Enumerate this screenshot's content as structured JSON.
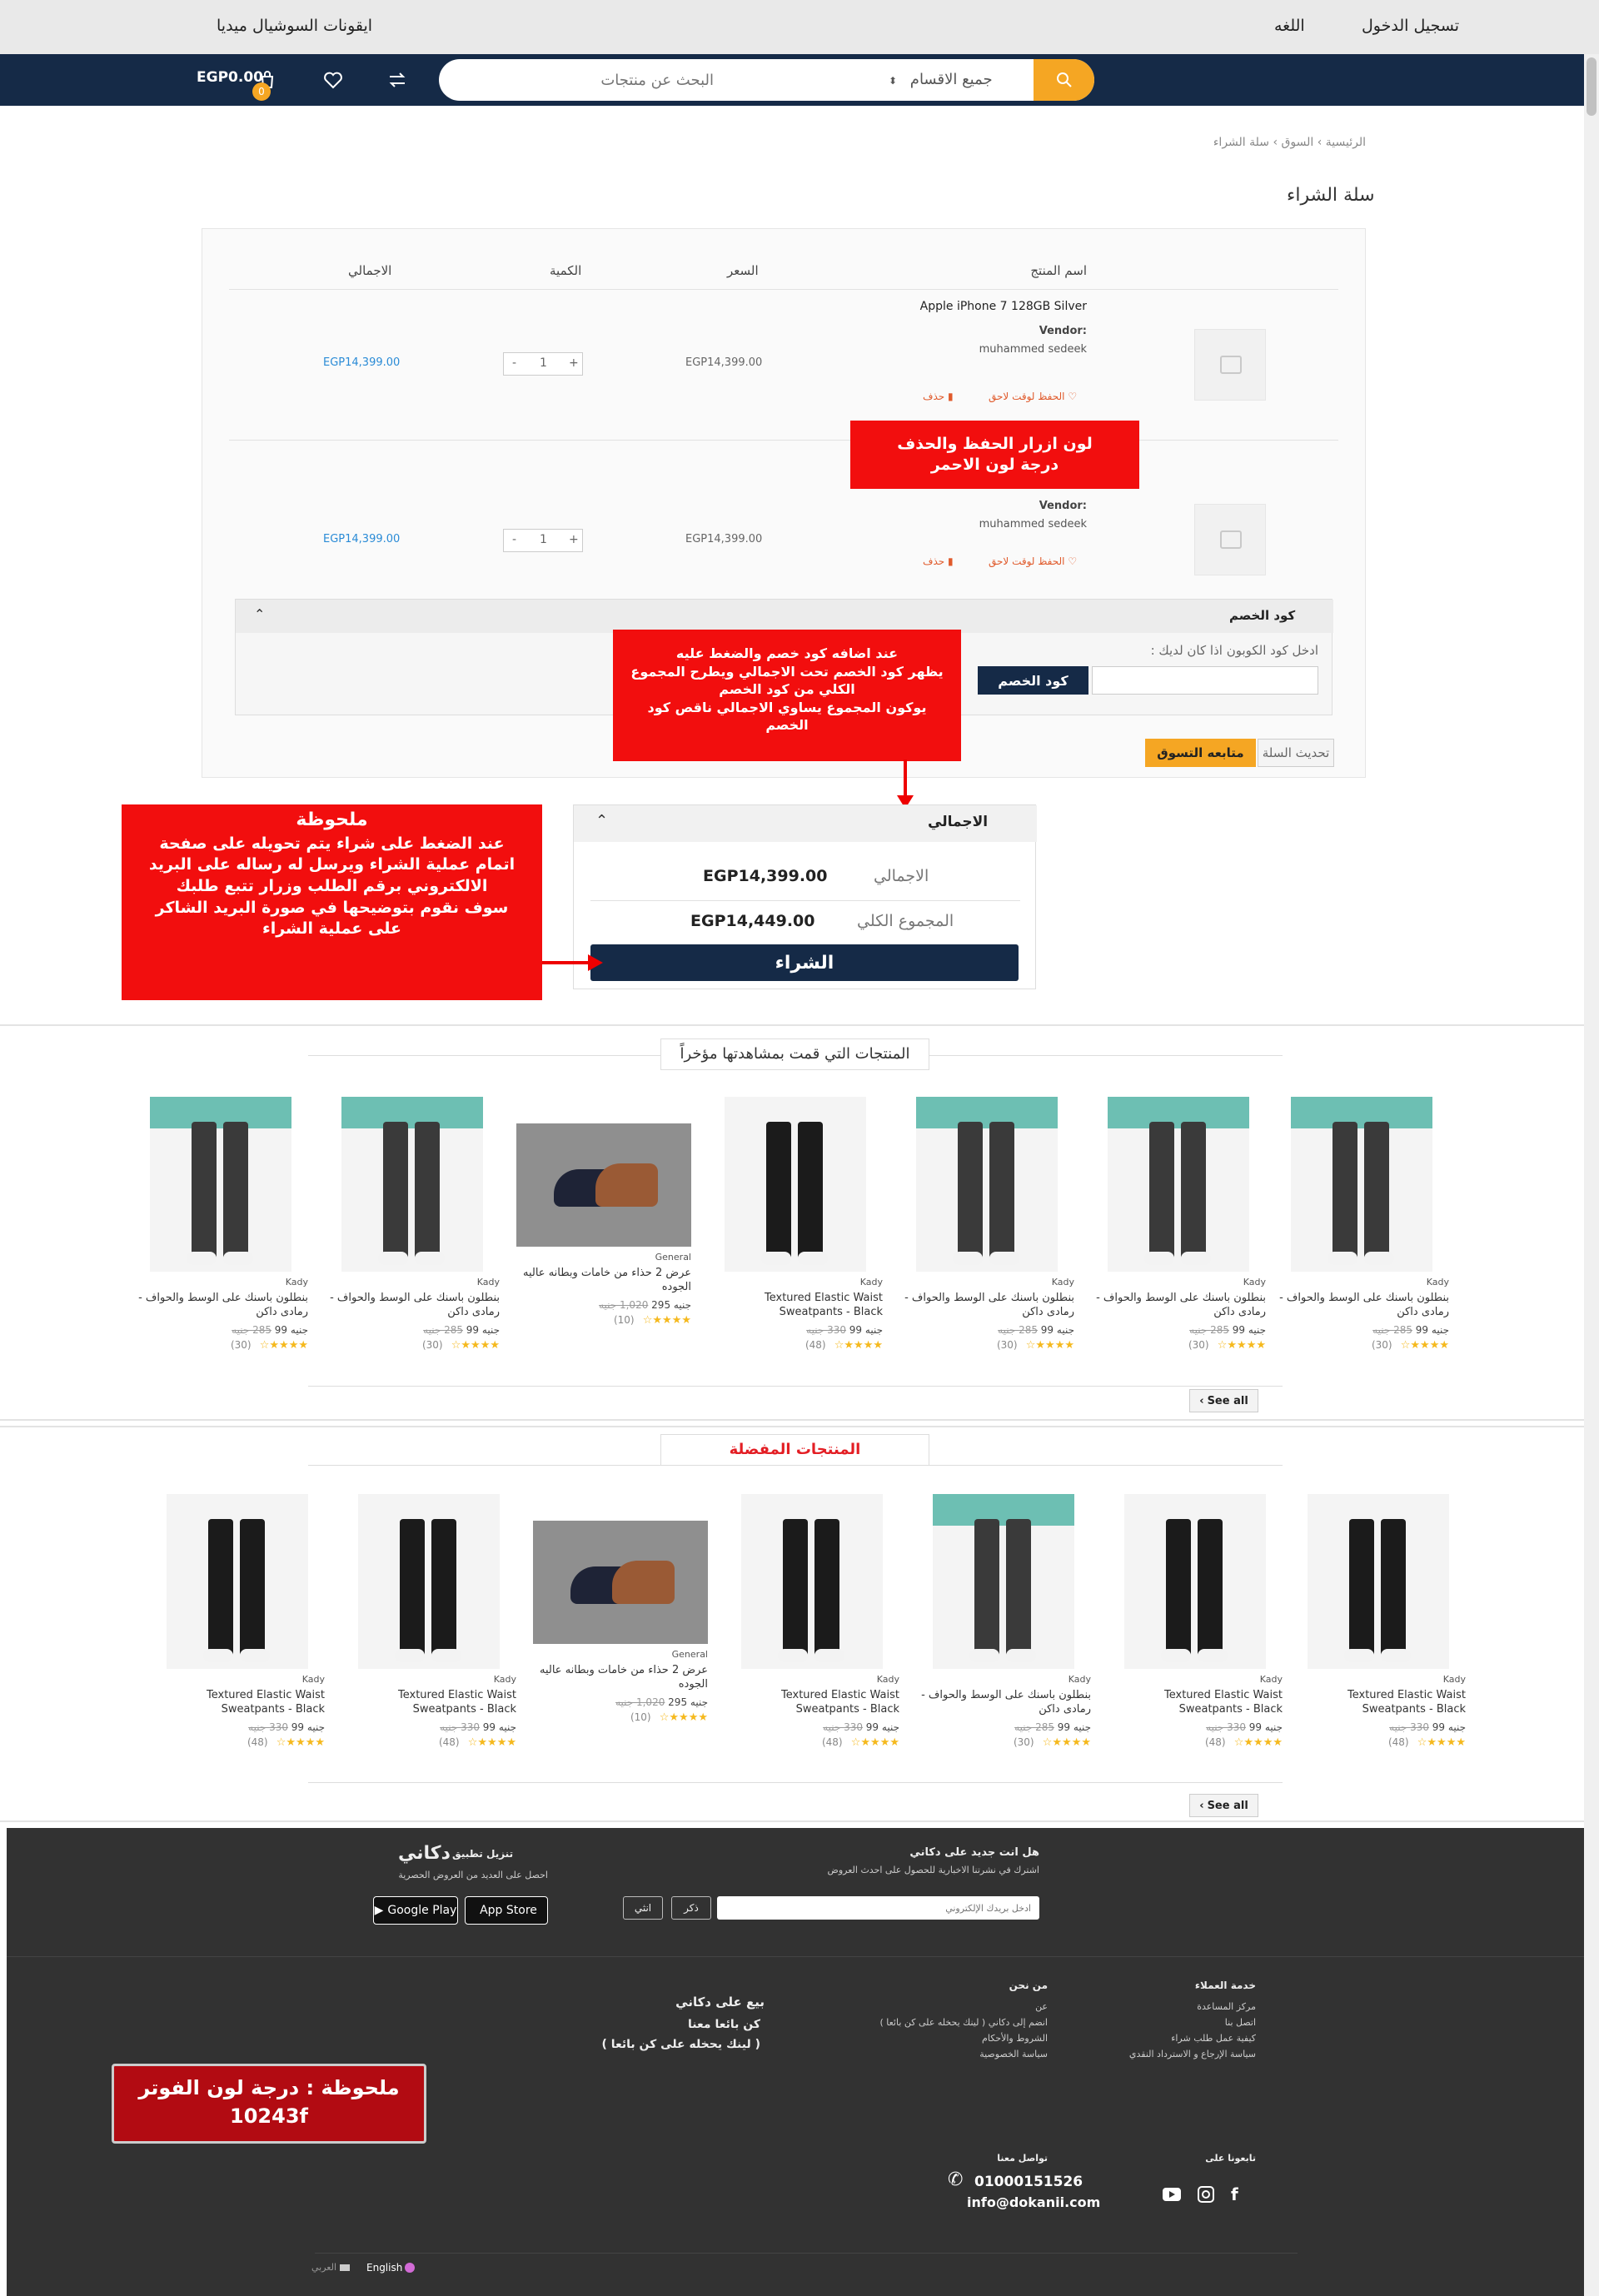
{
  "topbar": {
    "login": "تسجيل الدخول",
    "language": "اللغه",
    "social": "ايقونات السوشيال ميديا"
  },
  "navbar": {
    "search_placeholder": "البحث عن منتجات",
    "category": "جميع الاقسام",
    "cart_count": "0",
    "cart_total": "EGP0.00"
  },
  "breadcrumb": {
    "home": "الرئيسية",
    "market": "السوق",
    "current": "سلة الشراء"
  },
  "page_title": "سلة الشراء",
  "cart": {
    "headers": {
      "product": "اسم المنتج",
      "price": "السعر",
      "qty": "الكمية",
      "total": "الاجمالي"
    },
    "items": [
      {
        "name": "Apple iPhone 7 128GB Silver",
        "vendor_label": "Vendor:",
        "vendor": "muhammed sedeek",
        "price": "EGP14,399.00",
        "qty": "1",
        "total": "EGP14,399.00",
        "save": "الحفظ لوقت لاحق",
        "delete": "حذف"
      },
      {
        "name": "",
        "vendor_label": "Vendor:",
        "vendor": "muhammed sedeek",
        "price": "EGP14,399.00",
        "qty": "1",
        "total": "EGP14,399.00",
        "save": "الحفظ لوقت لاحق",
        "delete": "حذف"
      }
    ],
    "coupon": {
      "title": "كود الخصم",
      "prompt": "ادخل كود الكوبون اذا كان لديك :",
      "button": "كود الخصم"
    },
    "update_cart": "تحديث السلة",
    "continue_shopping": "متابعه التسوق"
  },
  "annotations": {
    "buttons_color": "لون ازرار الحفظ والحذف\nدرجة لون الاحمر",
    "coupon_note": "عند اضافه كود خصم والضغط عليه\nيظهر كود الخصم تحت الاجمالي ويطرح المجموع\nالكلي من كود الخصم\nيوكون المجموع يساوي الاجمالي ناقص كود\nالخصم",
    "note_title": "ملحوظة",
    "note_body": "عند الضغط على شراء يتم تحويله على صفحة\nاتمام عملية الشراء ويرسل له رساله على البريد\nالالكتروني برقم الطلب وزرار تتبع طلبك\nسوف نقوم بتوضيحها في صورة البريد الشاكر\nعلى عملية الشراء",
    "footer_note": "ملحوظة : درجة لون الفوتر\n10243f"
  },
  "totals": {
    "title": "الاجمالي",
    "subtotal_label": "الاجمالي",
    "subtotal": "EGP14,399.00",
    "grand_label": "المجموع الكلي",
    "grand": "EGP14,449.00",
    "buy": "الشراء"
  },
  "recent": {
    "title": "المنتجات التي قمت بمشاهدتها مؤخراً",
    "see_all": "See all",
    "products": [
      {
        "brand": "Kady",
        "name": "بنطلون باسنك على الوسط والحواف - رمادى داكن",
        "price": "جنيه 99",
        "old": "285 جنيه",
        "reviews": "(30)",
        "type": "jogger"
      },
      {
        "brand": "Kady",
        "name": "بنطلون باسنك على الوسط والحواف - رمادى داكن",
        "price": "جنيه 99",
        "old": "285 جنيه",
        "reviews": "(30)",
        "type": "jogger"
      },
      {
        "brand": "Kady",
        "name": "بنطلون باسنك على الوسط والحواف - رمادى داكن",
        "price": "جنيه 99",
        "old": "285 جنيه",
        "reviews": "(30)",
        "type": "jogger"
      },
      {
        "brand": "Kady",
        "name": "Textured Elastic Waist Sweatpants - Black",
        "price": "جنيه 99",
        "old": "330 جنيه",
        "reviews": "(48)",
        "type": "sweat"
      },
      {
        "brand": "General",
        "name": "عرض 2 حذاء من خامات وبطانه عاليه الجوده",
        "price": "جنيه 295",
        "old": "1,020 جنيه",
        "reviews": "(10)",
        "type": "shoes"
      },
      {
        "brand": "Kady",
        "name": "بنطلون باسنك على الوسط والحواف - رمادى داكن",
        "price": "جنيه 99",
        "old": "285 جنيه",
        "reviews": "(30)",
        "type": "jogger"
      },
      {
        "brand": "Kady",
        "name": "بنطلون باسنك على الوسط والحواف - رمادى داكن",
        "price": "جنيه 99",
        "old": "285 جنيه",
        "reviews": "(30)",
        "type": "jogger"
      }
    ]
  },
  "favorites": {
    "title": "المنتجات المفضلة",
    "see_all": "See all",
    "products": [
      {
        "brand": "Kady",
        "name": "Textured Elastic Waist Sweatpants - Black",
        "price": "جنيه 99",
        "old": "330 جنيه",
        "reviews": "(48)",
        "type": "sweat"
      },
      {
        "brand": "Kady",
        "name": "Textured Elastic Waist Sweatpants - Black",
        "price": "جنيه 99",
        "old": "330 جنيه",
        "reviews": "(48)",
        "type": "sweat"
      },
      {
        "brand": "Kady",
        "name": "بنطلون باسنك على الوسط والحواف - رمادى داكن",
        "price": "جنيه 99",
        "old": "285 جنيه",
        "reviews": "(30)",
        "type": "jogger"
      },
      {
        "brand": "Kady",
        "name": "Textured Elastic Waist Sweatpants - Black",
        "price": "جنيه 99",
        "old": "330 جنيه",
        "reviews": "(48)",
        "type": "sweat"
      },
      {
        "brand": "General",
        "name": "عرض 2 حذاء من خامات وبطانه عاليه الجوده",
        "price": "جنيه 295",
        "old": "1,020 جنيه",
        "reviews": "(10)",
        "type": "shoes"
      },
      {
        "brand": "Kady",
        "name": "Textured Elastic Waist Sweatpants - Black",
        "price": "جنيه 99",
        "old": "330 جنيه",
        "reviews": "(48)",
        "type": "sweat"
      },
      {
        "brand": "Kady",
        "name": "Textured Elastic Waist Sweatpants - Black",
        "price": "جنيه 99",
        "old": "330 جنيه",
        "reviews": "(48)",
        "type": "sweat"
      }
    ]
  },
  "footer": {
    "newsletter_title": "هل انت جديد على  دكاني",
    "newsletter_sub": "اشترك في نشرتنا الاخبارية للحصول على احدث العروض",
    "email_placeholder": "ادخل بريدك الإلكتروني",
    "male": "ذكر",
    "female": "انثي",
    "app_title": "تنزيل تطبيق",
    "brand": "دكاني",
    "app_sub": "احصل على العديد من العروض الحصرية",
    "google_play": "Google Play",
    "app_store": "App Store",
    "customer_service": {
      "title": "خدمة العملاء",
      "links": [
        "مركز المساعدة",
        "اتصل بنا",
        "كيفية عمل طلب شراء",
        "سياسة الإرجاع و الاسترداد النقدي"
      ]
    },
    "about": {
      "title": "من نحن",
      "links": [
        "عن",
        "انضم إلى  دكاني  ( لينك يحخله على كن بائعا )",
        "الشروط والأحكام",
        "سياسة الخصوصية"
      ]
    },
    "sell": {
      "title": "بيع على دكاني",
      "line1": "كن بائعا معنا",
      "line2": "( لينك يحخله على كن بائعا )"
    },
    "follow": "تابعونا على",
    "contact_title": "تواصل معنا",
    "phone": "01000151526",
    "email": "info@dokanii.com",
    "lang_en": "English",
    "lang_ar": "العربي"
  }
}
